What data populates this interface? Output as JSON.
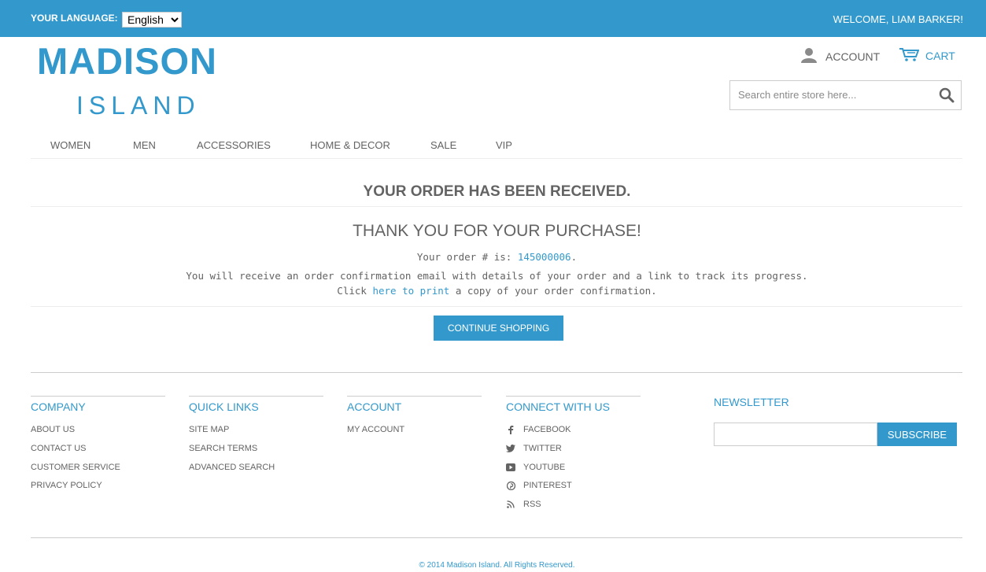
{
  "topbar": {
    "language_label": "YOUR LANGUAGE:",
    "language_value": "English",
    "welcome": "WELCOME, LIAM BARKER!"
  },
  "logo": {
    "line1": "MADISON",
    "line2": "ISLAND"
  },
  "header": {
    "account_label": "ACCOUNT",
    "cart_label": "CART",
    "search_placeholder": "Search entire store here..."
  },
  "nav": [
    "WOMEN",
    "MEN",
    "ACCESSORIES",
    "HOME & DECOR",
    "SALE",
    "VIP"
  ],
  "main": {
    "title": "YOUR ORDER HAS BEEN RECEIVED.",
    "subtitle": "THANK YOU FOR YOUR PURCHASE!",
    "order_prefix": "Your order # is: ",
    "order_number": "145000006",
    "order_suffix": ".",
    "email_note": "You will receive an order confirmation email with details of your order and a link to track its progress.",
    "print_prefix": "Click ",
    "print_link": "here to print",
    "print_suffix": " a copy of your order confirmation.",
    "continue_label": "CONTINUE SHOPPING"
  },
  "footer": {
    "company": {
      "title": "COMPANY",
      "items": [
        "ABOUT US",
        "CONTACT US",
        "CUSTOMER SERVICE",
        "PRIVACY POLICY"
      ]
    },
    "quick_links": {
      "title": "QUICK LINKS",
      "items": [
        "SITE MAP",
        "SEARCH TERMS",
        "ADVANCED SEARCH"
      ]
    },
    "account": {
      "title": "ACCOUNT",
      "items": [
        "MY ACCOUNT"
      ]
    },
    "connect": {
      "title": "CONNECT WITH US",
      "items": [
        {
          "label": "FACEBOOK",
          "icon": "facebook-icon"
        },
        {
          "label": "TWITTER",
          "icon": "twitter-icon"
        },
        {
          "label": "YOUTUBE",
          "icon": "youtube-icon"
        },
        {
          "label": "PINTEREST",
          "icon": "pinterest-icon"
        },
        {
          "label": "RSS",
          "icon": "rss-icon"
        }
      ]
    },
    "newsletter": {
      "title": "NEWSLETTER",
      "subscribe_label": "SUBSCRIBE",
      "input_value": ""
    },
    "copyright": "© 2014 Madison Island. All Rights Reserved."
  },
  "colors": {
    "accent": "#3399cc",
    "text": "#636363",
    "border": "#cccccc"
  }
}
